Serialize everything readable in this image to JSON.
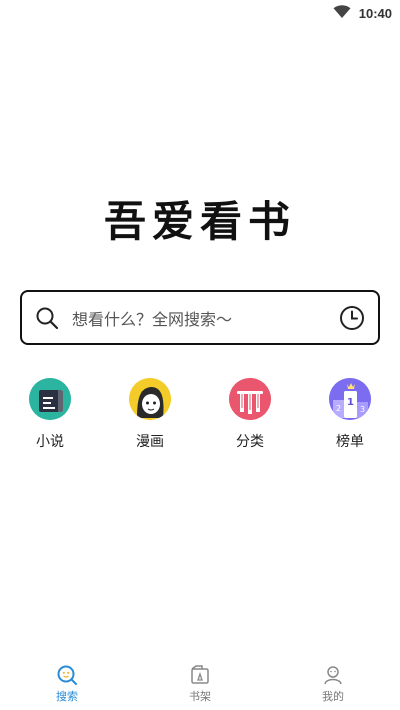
{
  "status_bar": {
    "time": "10:40",
    "wifi_icon": "wifi-icon"
  },
  "logo": {
    "text": "吾爱看书"
  },
  "search": {
    "placeholder": "想看什么？全网搜索～",
    "search_icon": "search-icon",
    "history_icon": "history-clock-icon"
  },
  "shortcuts": [
    {
      "label": "小说",
      "icon": "novel-book-icon",
      "color": "#2bb5a0"
    },
    {
      "label": "漫画",
      "icon": "comic-character-icon",
      "color": "#f4cc2a"
    },
    {
      "label": "分类",
      "icon": "category-icon",
      "color": "#e9566d"
    },
    {
      "label": "榜单",
      "icon": "ranking-podium-icon",
      "color": "#7b6cf0"
    }
  ],
  "bottom_nav": {
    "active_color": "#2a8bd6",
    "items": [
      {
        "label": "搜索",
        "icon": "search-tab-icon",
        "active": true
      },
      {
        "label": "书架",
        "icon": "bookshelf-tab-icon",
        "active": false
      },
      {
        "label": "我的",
        "icon": "profile-tab-icon",
        "active": false
      }
    ]
  }
}
